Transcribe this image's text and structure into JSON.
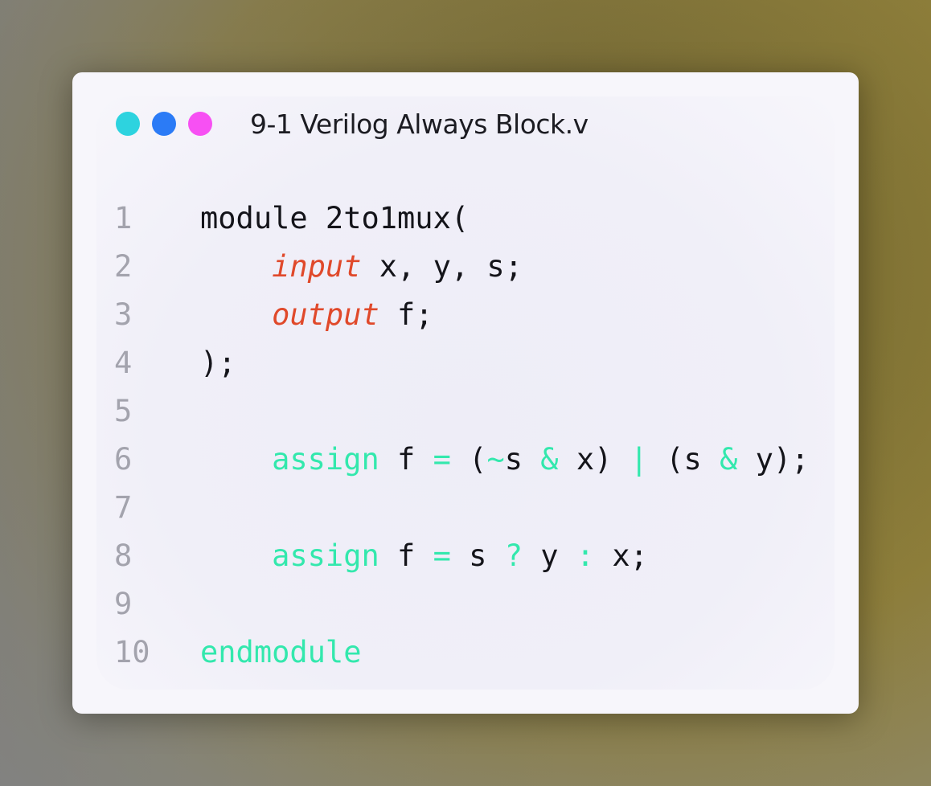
{
  "window": {
    "title": "9-1 Verilog Always Block.v",
    "dots": [
      {
        "name": "dot-cyan",
        "color": "#2dd3df"
      },
      {
        "name": "dot-blue",
        "color": "#2b7bf6"
      },
      {
        "name": "dot-magenta",
        "color": "#f750f3"
      }
    ]
  },
  "colors": {
    "line_number": "#a3a3ad",
    "plain_text": "#14141a",
    "keyword_italic": "#e0492b",
    "keyword_green": "#33e8ad"
  },
  "code": {
    "lines": [
      {
        "number": "1",
        "tokens": [
          {
            "type": "plain",
            "text": "module 2to1mux("
          }
        ]
      },
      {
        "number": "2",
        "tokens": [
          {
            "type": "plain",
            "text": "    "
          },
          {
            "type": "kw",
            "text": "input"
          },
          {
            "type": "plain",
            "text": " x, y, s;"
          }
        ]
      },
      {
        "number": "3",
        "tokens": [
          {
            "type": "plain",
            "text": "    "
          },
          {
            "type": "kw",
            "text": "output"
          },
          {
            "type": "plain",
            "text": " f;"
          }
        ]
      },
      {
        "number": "4",
        "tokens": [
          {
            "type": "plain",
            "text": ");"
          }
        ]
      },
      {
        "number": "5",
        "tokens": []
      },
      {
        "number": "6",
        "tokens": [
          {
            "type": "plain",
            "text": "    "
          },
          {
            "type": "green",
            "text": "assign"
          },
          {
            "type": "plain",
            "text": " f "
          },
          {
            "type": "green",
            "text": "="
          },
          {
            "type": "plain",
            "text": " ("
          },
          {
            "type": "green",
            "text": "~"
          },
          {
            "type": "plain",
            "text": "s "
          },
          {
            "type": "green",
            "text": "&"
          },
          {
            "type": "plain",
            "text": " x) "
          },
          {
            "type": "green",
            "text": "|"
          },
          {
            "type": "plain",
            "text": " (s "
          },
          {
            "type": "green",
            "text": "&"
          },
          {
            "type": "plain",
            "text": " y);"
          }
        ]
      },
      {
        "number": "7",
        "tokens": []
      },
      {
        "number": "8",
        "tokens": [
          {
            "type": "plain",
            "text": "    "
          },
          {
            "type": "green",
            "text": "assign"
          },
          {
            "type": "plain",
            "text": " f "
          },
          {
            "type": "green",
            "text": "="
          },
          {
            "type": "plain",
            "text": " s "
          },
          {
            "type": "green",
            "text": "?"
          },
          {
            "type": "plain",
            "text": " y "
          },
          {
            "type": "green",
            "text": ":"
          },
          {
            "type": "plain",
            "text": " x;"
          }
        ]
      },
      {
        "number": "9",
        "tokens": []
      },
      {
        "number": "10",
        "tokens": [
          {
            "type": "green",
            "text": "endmodule"
          }
        ]
      }
    ]
  }
}
